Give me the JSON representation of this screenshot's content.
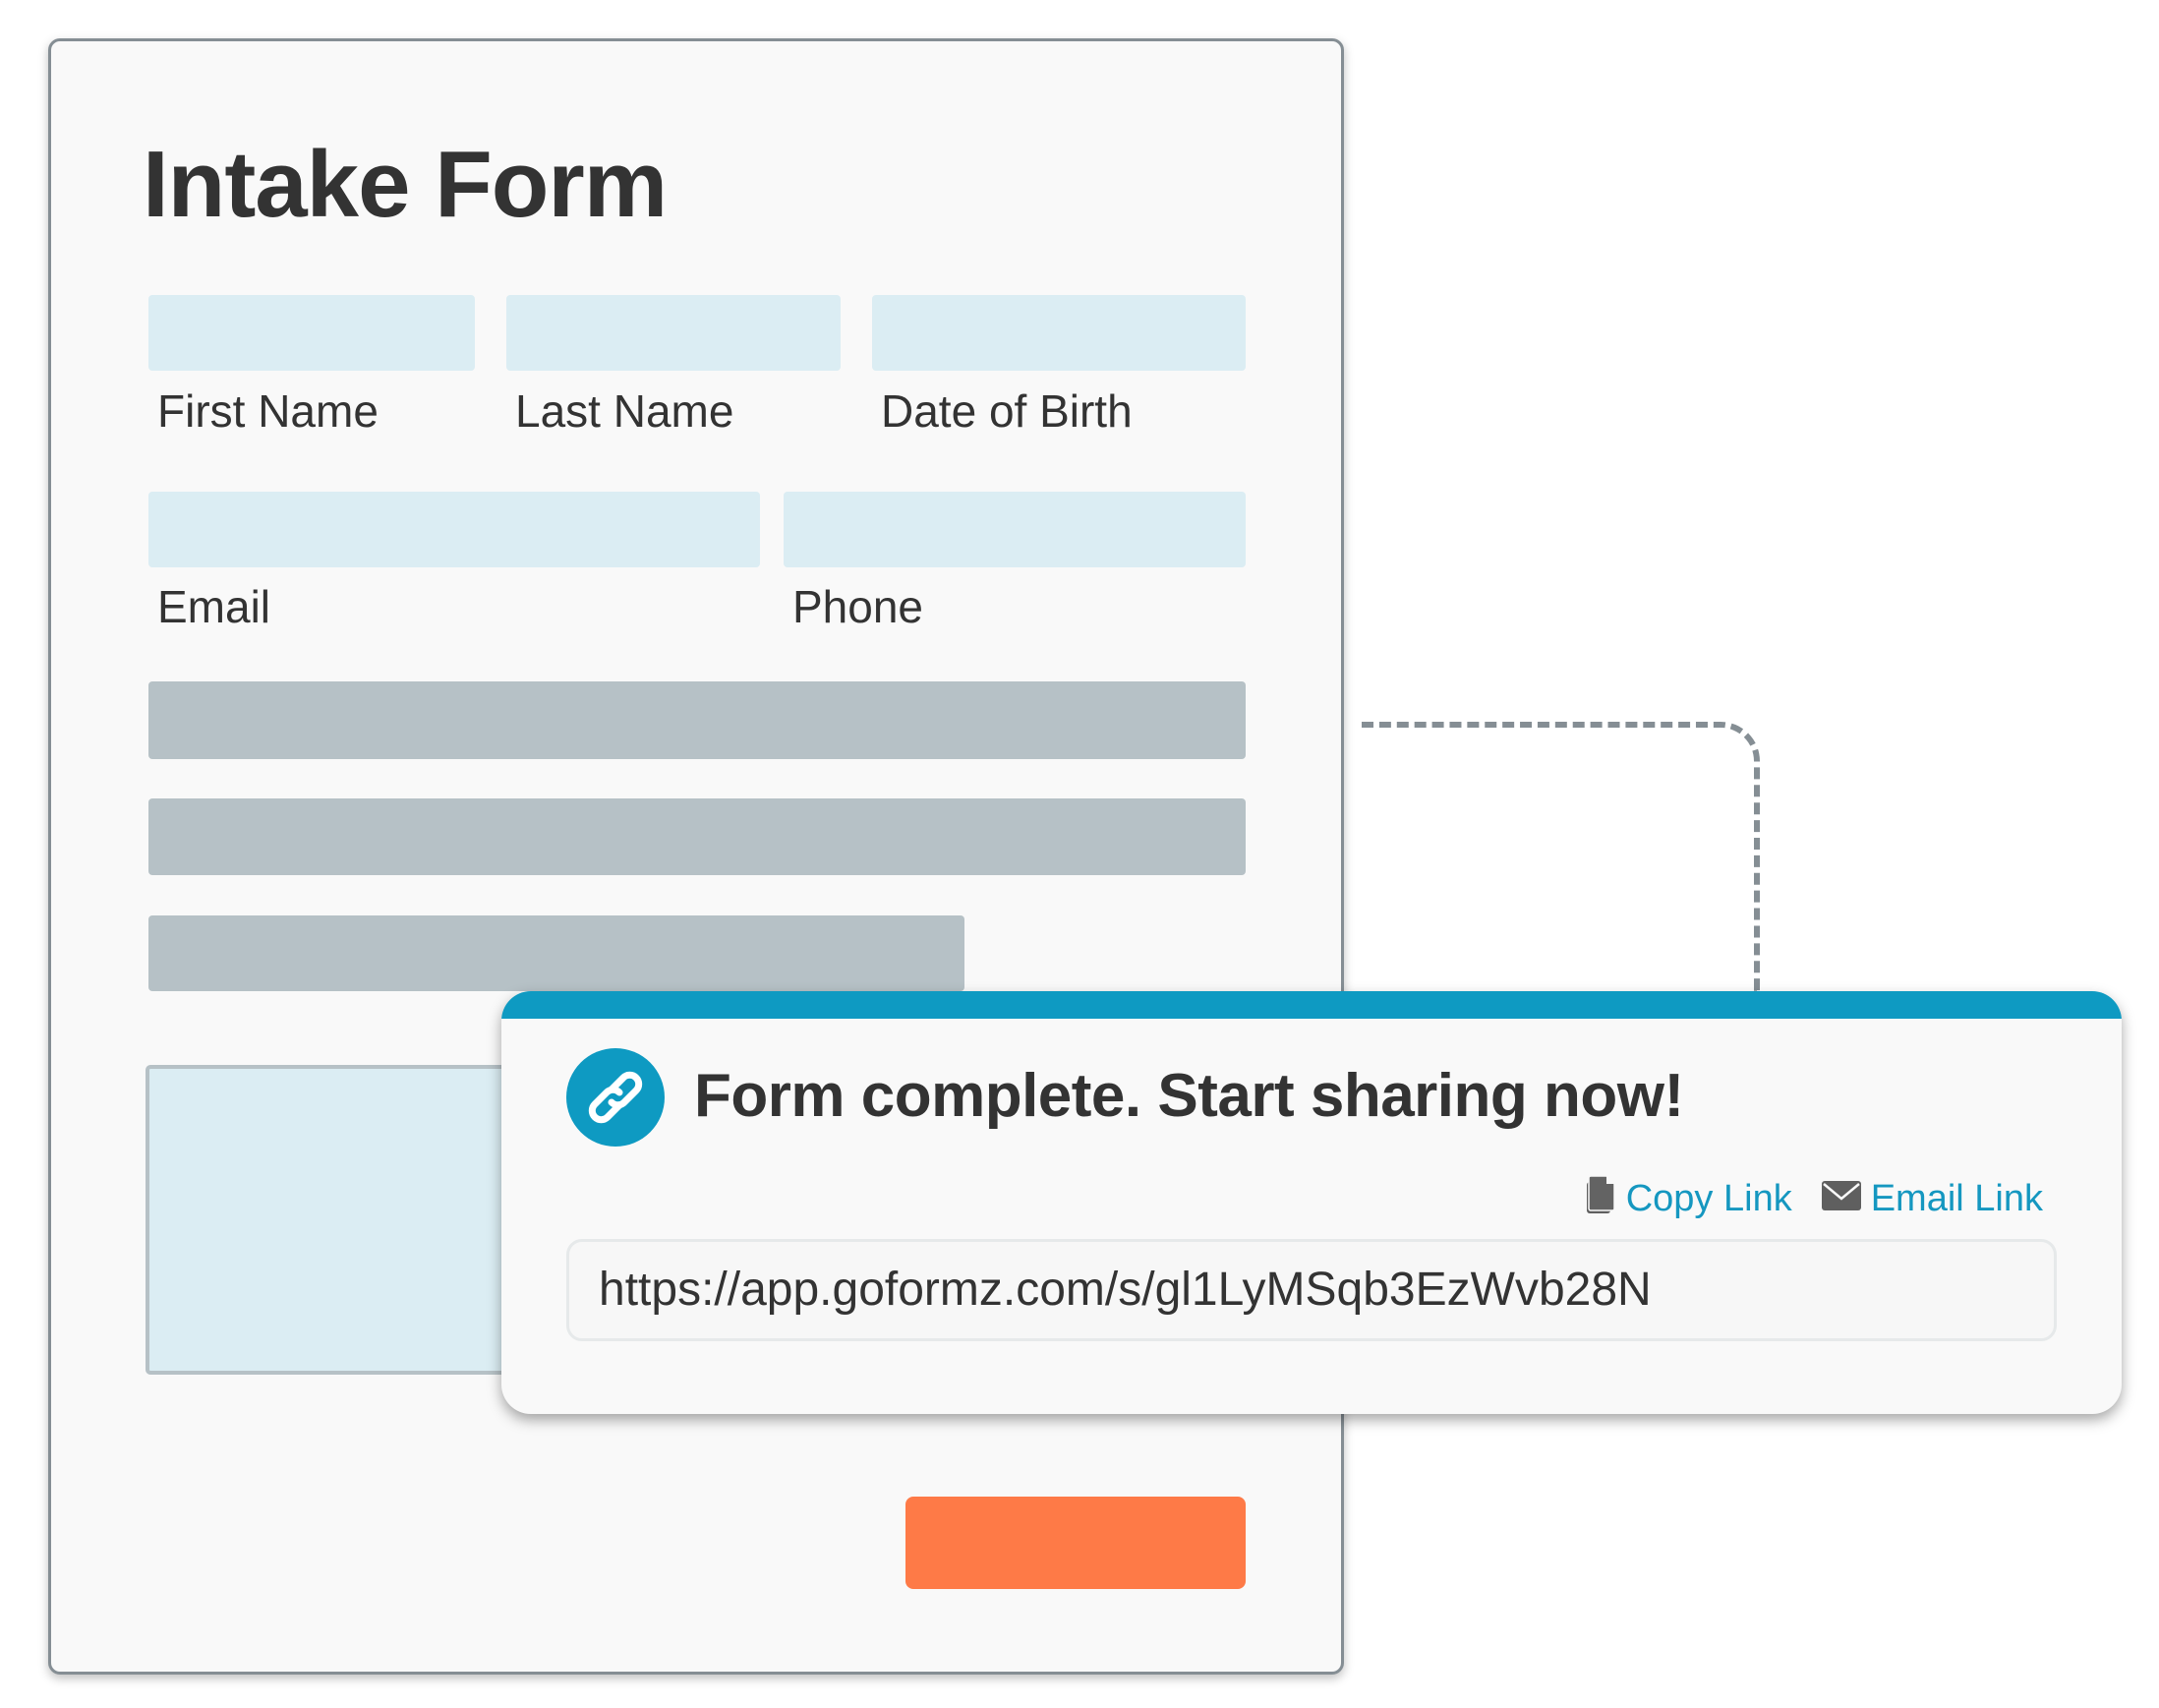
{
  "form": {
    "title": "Intake Form",
    "fields": [
      {
        "label": "First Name",
        "value": ""
      },
      {
        "label": "Last Name",
        "value": ""
      },
      {
        "label": "Date of Birth",
        "value": ""
      },
      {
        "label": "Email",
        "value": ""
      },
      {
        "label": "Phone",
        "value": ""
      }
    ]
  },
  "popup": {
    "title": "Form complete. Start sharing now!",
    "icon": "link-icon",
    "actions": [
      {
        "label": "Copy Link",
        "icon": "copy-document-icon"
      },
      {
        "label": "Email Link",
        "icon": "envelope-icon"
      }
    ],
    "url": "https://app.goformz.com/s/gl1LyMSqb3EzWvb28N"
  },
  "colors": {
    "accent": "#0e9ac2",
    "link": "#1597c0",
    "field": "#dbedf3",
    "placeholder_bar": "#b6c1c6",
    "submit": "#fe7a47",
    "border": "#858e94",
    "text": "#333333"
  }
}
